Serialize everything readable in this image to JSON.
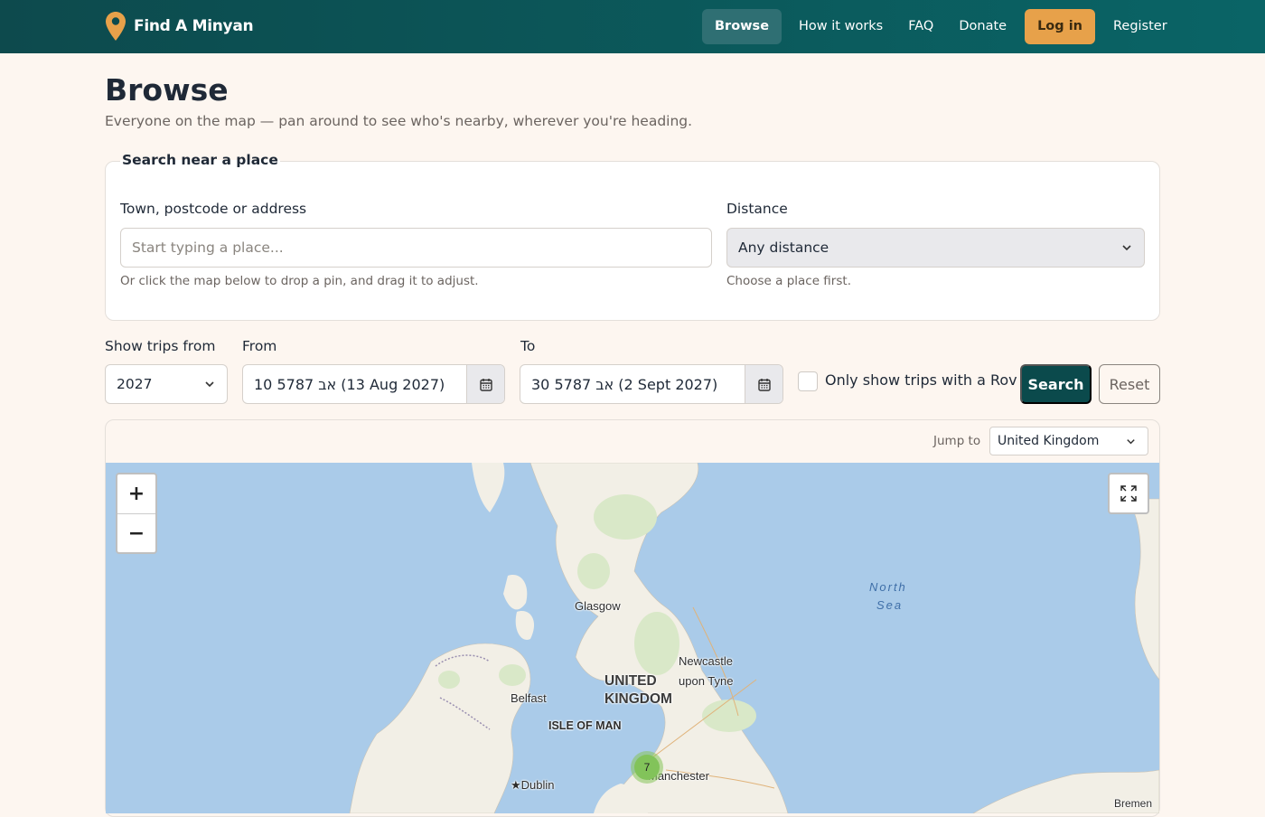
{
  "nav": {
    "brand": "Find A Minyan",
    "links": [
      {
        "label": "Browse"
      },
      {
        "label": "How it works"
      },
      {
        "label": "FAQ"
      },
      {
        "label": "Donate"
      },
      {
        "label": "Log in"
      },
      {
        "label": "Register"
      }
    ]
  },
  "page": {
    "title": "Browse",
    "subtitle": "Everyone on the map — pan around to see who's nearby, wherever you're heading."
  },
  "search": {
    "legend": "Search near a place",
    "place_label": "Town, postcode or address",
    "place_placeholder": "Start typing a place...",
    "place_help": "Or click the map below to drop a pin, and drag it to adjust.",
    "distance_label": "Distance",
    "distance_value": "Any distance",
    "distance_help": "Choose a place first."
  },
  "filters": {
    "year_label": "Show trips from",
    "year_value": "2027",
    "from_label": "From",
    "from_value": "10 אב 5787 (13 Aug 2027)",
    "to_label": "To",
    "to_value": "30 אב 5787 (2 Sept 2027)",
    "rov_label": "Only show trips with a Rov",
    "rov_checked": false,
    "search_button": "Search",
    "reset_button": "Reset"
  },
  "map": {
    "jump_label": "Jump to",
    "jump_value": "United Kingdom",
    "zoom_in": "+",
    "zoom_out": "−",
    "labels": {
      "glasgow": "Glasgow",
      "newcastle_1": "Newcastle",
      "newcastle_2": "upon Tyne",
      "uk_1": "UNITED",
      "uk_2": "KINGDOM",
      "belfast": "Belfast",
      "isle_of_man": "ISLE OF MAN",
      "manchester": "Manchester",
      "dublin": "Dublin",
      "north_sea_1": "North",
      "north_sea_2": "Sea",
      "bremen": "Bremen"
    },
    "cluster_count": "7",
    "colors": {
      "water": "#aacbe9",
      "land": "#f2efe6",
      "park": "#d9e8c8",
      "cluster": "#82c35a"
    }
  }
}
